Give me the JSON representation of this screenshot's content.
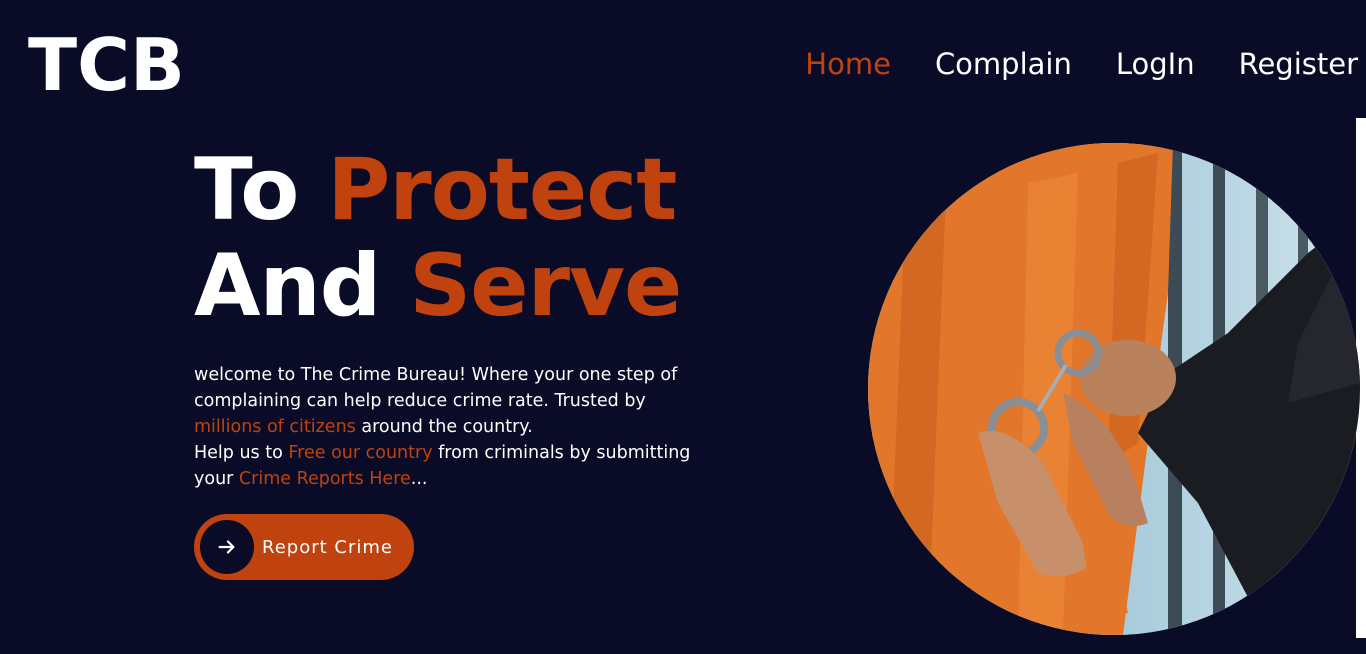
{
  "brand": {
    "logo_text": "TCB"
  },
  "nav": {
    "items": [
      {
        "label": "Home",
        "active": true
      },
      {
        "label": "Complain",
        "active": false
      },
      {
        "label": "LogIn",
        "active": false
      },
      {
        "label": "Register",
        "active": false
      }
    ]
  },
  "hero": {
    "line1_plain": "To ",
    "line1_accent": "Protect",
    "line2_plain": "And ",
    "line2_accent": "Serve",
    "desc_part1": "welcome to The Crime Bureau! Where your one step of complaining can help reduce crime rate. Trusted by ",
    "desc_hl1": "millions of citizens",
    "desc_part2": " around the country.",
    "desc_part3": "Help us to ",
    "desc_hl2": "Free our country",
    "desc_part4": " from criminals by submitting your ",
    "desc_hl3": "Crime Reports Here",
    "desc_part5": "...",
    "button_label": "Report Crime",
    "button_icon": "arrow-right-icon"
  },
  "colors": {
    "background": "#0a0b27",
    "accent": "#c0420f",
    "text": "#ffffff"
  }
}
